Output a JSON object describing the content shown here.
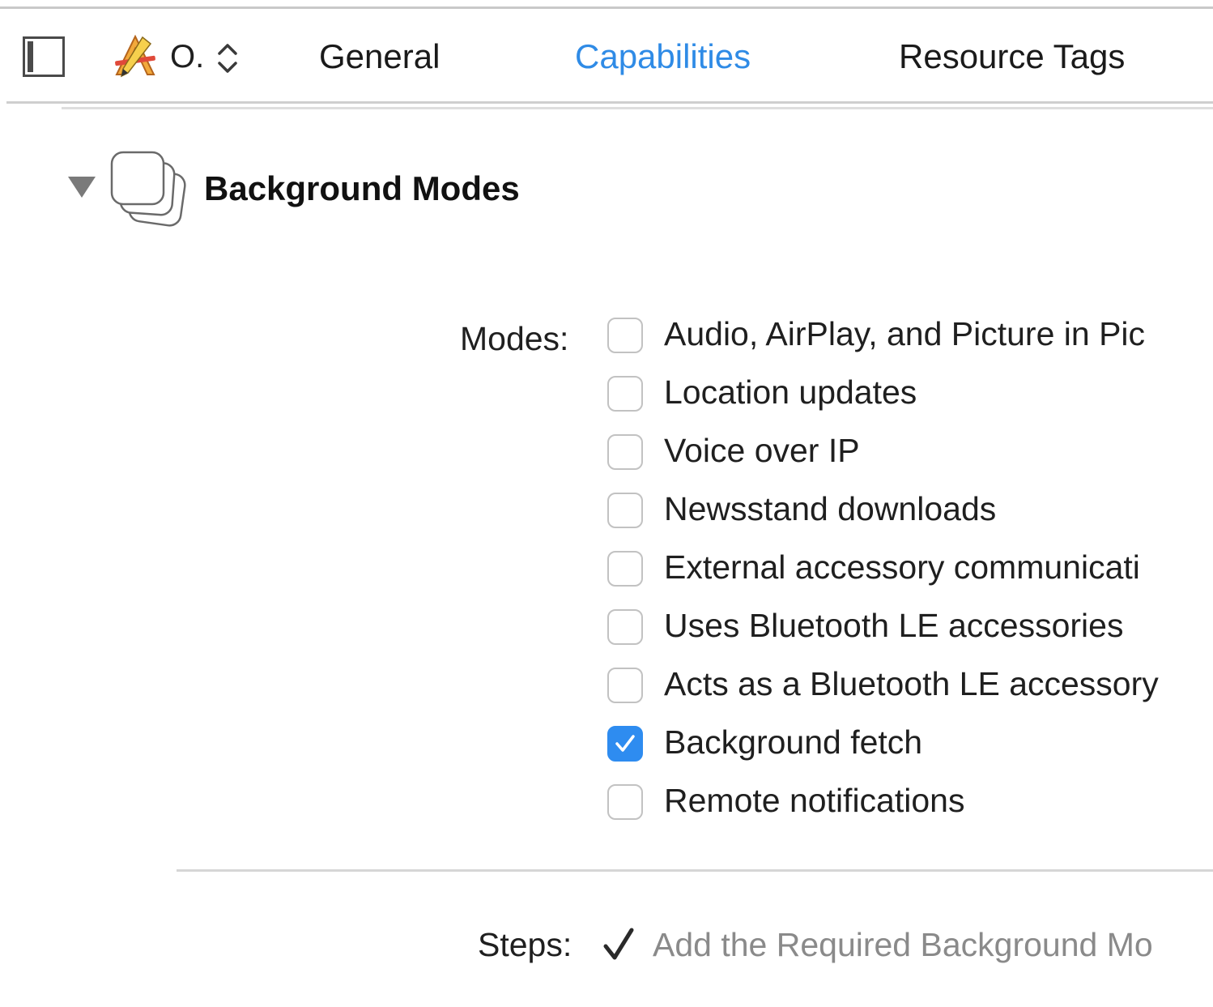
{
  "toolbar": {
    "target_name": "O.",
    "tabs": [
      {
        "label": "General",
        "active": false
      },
      {
        "label": "Capabilities",
        "active": true
      },
      {
        "label": "Resource Tags",
        "active": false
      }
    ],
    "active_tab_color": "#2f8be6"
  },
  "icons": {
    "sidebar_toggle": "sidebar-toggle-icon",
    "target": "app-target-icon",
    "stepper": "up-down-stepper-icon",
    "disclosure": "disclosure-triangle-icon",
    "section": "background-modes-icon",
    "step_check": "checkmark-icon"
  },
  "section": {
    "title": "Background Modes",
    "expanded": true,
    "modes_label": "Modes:",
    "modes": [
      {
        "label": "Audio, AirPlay, and Picture in Pic",
        "checked": false
      },
      {
        "label": "Location updates",
        "checked": false
      },
      {
        "label": "Voice over IP",
        "checked": false
      },
      {
        "label": "Newsstand downloads",
        "checked": false
      },
      {
        "label": "External accessory communicati",
        "checked": false
      },
      {
        "label": "Uses Bluetooth LE accessories",
        "checked": false
      },
      {
        "label": "Acts as a Bluetooth LE accessory",
        "checked": false
      },
      {
        "label": "Background fetch",
        "checked": true
      },
      {
        "label": "Remote notifications",
        "checked": false
      }
    ],
    "checkbox_checked_color": "#2e8cf0",
    "steps_label": "Steps:",
    "step_text": "Add the Required Background Mo"
  }
}
